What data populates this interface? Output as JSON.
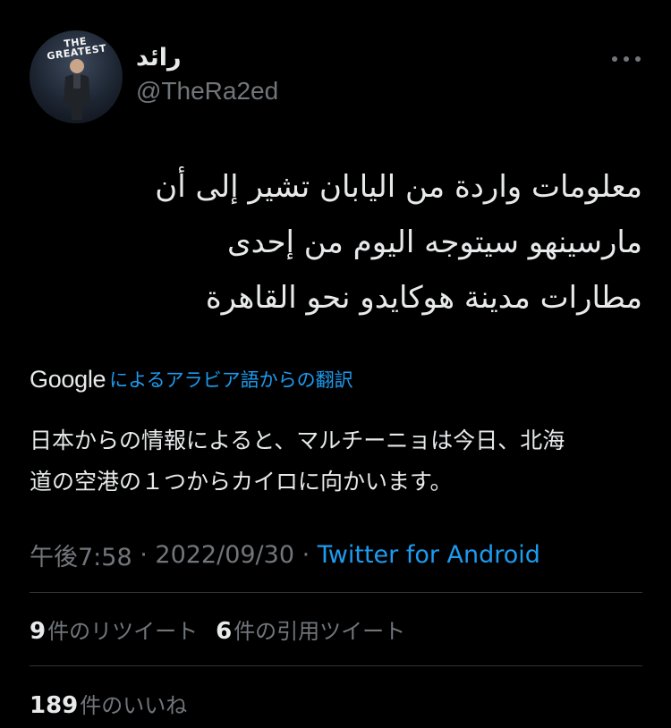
{
  "author": {
    "display_name": "رائد",
    "handle": "@TheRa2ed",
    "avatar_banner_text": "THE GREATEST"
  },
  "more_icon": "more-horizontal-icon",
  "tweet": {
    "text": "معلومات واردة من اليابان تشير إلى أن\nمارسينهو سيتوجه اليوم من إحدى\nمطارات مدينة هوكايدو نحو القاهرة",
    "translation_provider": "Google",
    "translation_link": "によるアラビア語からの翻訳",
    "translated_text": "日本からの情報によると、マルチーニョは今日、北海\n道の空港の１つからカイロに向かいます。",
    "time": "午後7:58",
    "separator_1": " · ",
    "date": "2022/09/30",
    "separator_2": " · ",
    "source": "Twitter for Android"
  },
  "stats": {
    "retweets_count": "9",
    "retweets_label": "件のリツイート",
    "quotes_count": "6",
    "quotes_label": "件の引用ツイート",
    "likes_count": "189",
    "likes_label": "件のいいね"
  },
  "colors": {
    "background": "#000000",
    "text_primary": "#e7e9ea",
    "text_secondary": "#71767b",
    "link": "#1d9bf0",
    "divider": "#2f3336"
  }
}
